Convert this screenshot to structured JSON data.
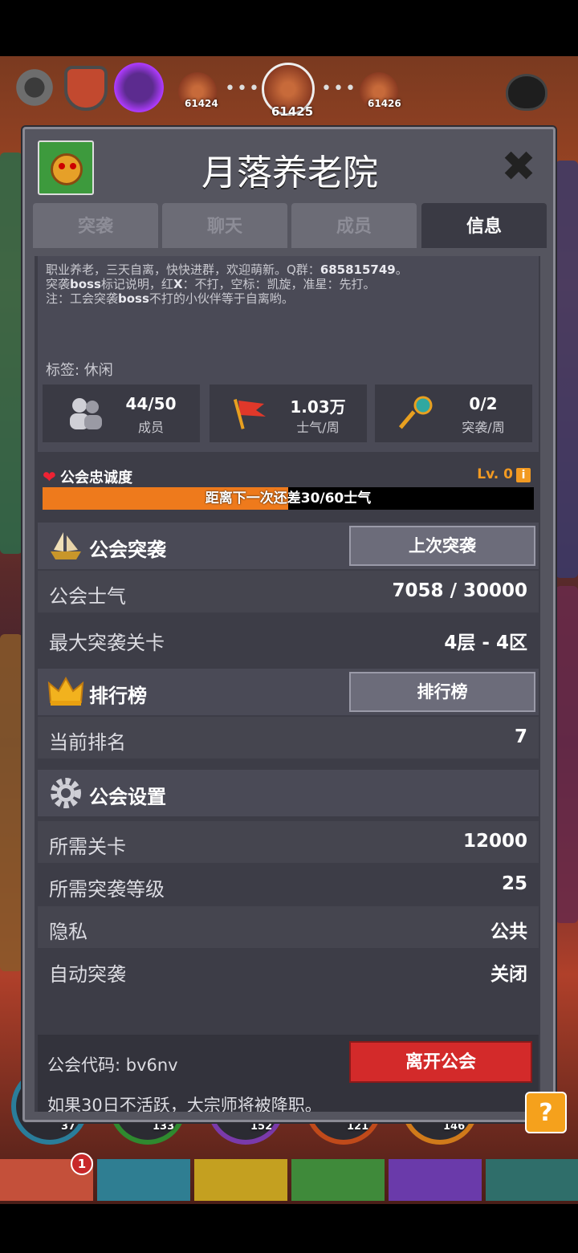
{
  "top_bar": {
    "stages": [
      {
        "number": "61424"
      },
      {
        "number": "61425"
      },
      {
        "number": "61426"
      }
    ]
  },
  "dialog": {
    "title": "月落养老院",
    "close_glyph": "✖",
    "tabs": [
      {
        "label": "突袭",
        "active": false
      },
      {
        "label": "聊天",
        "active": false
      },
      {
        "label": "成员",
        "active": false
      },
      {
        "label": "信息",
        "active": true
      }
    ],
    "description": {
      "line1_prefix": "职业养老，三天自离，快快进群，欢迎萌新。Q群：",
      "line1_qq": "685815749",
      "line1_suffix": "。",
      "line2_a": "突袭",
      "line2_b": "boss",
      "line2_c": "标记说明，红",
      "line2_d": "X",
      "line2_e": "：不打，空标：凯旋，准星：先打。",
      "line3_a": "注：工会突袭",
      "line3_b": "boss",
      "line3_c": "不打的小伙伴等于自离哟。"
    },
    "tags_label": "标签: 休闲",
    "stats": [
      {
        "value": "44/50",
        "label": "成员",
        "icon": "members-icon"
      },
      {
        "value": "1.03万",
        "label": "士气/周",
        "icon": "flag-icon"
      },
      {
        "value": "0/2",
        "label": "突袭/周",
        "icon": "key-icon"
      }
    ],
    "loyalty": {
      "title": "公会忠诚度",
      "level": "Lv. 0",
      "info_glyph": "i",
      "progress_text": "距离下一次还差30/60士气",
      "progress": 0.5
    },
    "raid_section": {
      "title": "公会突袭",
      "button": "上次突袭",
      "rows": [
        {
          "key": "公会士气",
          "value": "7058 / 30000"
        },
        {
          "key": "最大突袭关卡",
          "value": "4层 - 4区"
        }
      ]
    },
    "ranking_section": {
      "title": "排行榜",
      "button": "排行榜",
      "rows": [
        {
          "key": "当前排名",
          "value": "7"
        }
      ]
    },
    "settings_section": {
      "title": "公会设置",
      "rows": [
        {
          "key": "所需关卡",
          "value": "12000"
        },
        {
          "key": "所需突袭等级",
          "value": "25"
        },
        {
          "key": "隐私",
          "value": "公共"
        },
        {
          "key": "自动突袭",
          "value": "关闭"
        }
      ]
    },
    "footer": {
      "code_label": "公会代码: bv6nv",
      "leave_button": "离开公会",
      "warning": "如果30日不活跃，大宗师将被降职。"
    }
  },
  "help_glyph": "?",
  "ring_numbers": [
    "37",
    "133",
    "152",
    "121",
    "146"
  ],
  "bottom_badge": "1",
  "colors": {
    "accent_orange": "#ee7a1c",
    "leave_red": "#d32a2a",
    "panel_dark": "#3d3d47"
  }
}
